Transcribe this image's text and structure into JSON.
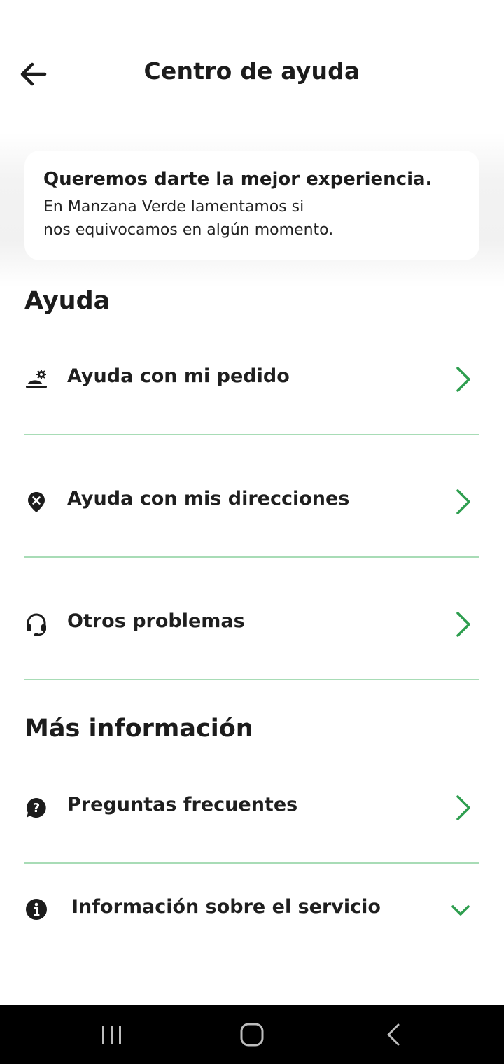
{
  "header": {
    "title": "Centro de ayuda",
    "back_icon": "arrow-left-icon"
  },
  "banner": {
    "title": "Queremos darte la mejor experiencia.",
    "text_line1": "En Manzana Verde lamentamos si",
    "text_line2": "nos equivocamos en algún momento."
  },
  "sections": {
    "help": {
      "title": "Ayuda",
      "items": [
        {
          "label": "Ayuda con mi pedido",
          "icon": "food-service-bell-icon"
        },
        {
          "label": "Ayuda con mis direcciones",
          "icon": "location-pin-x-icon"
        },
        {
          "label": "Otros problemas",
          "icon": "headset-icon"
        }
      ]
    },
    "more_info": {
      "title": "Más información",
      "items": [
        {
          "label": "Preguntas frecuentes",
          "icon": "question-bubble-icon"
        },
        {
          "label": "Información sobre el servicio",
          "icon": "info-circle-icon",
          "expanded": false
        }
      ]
    }
  },
  "colors": {
    "accent": "#2e9e4f",
    "divider": "#a8dcb6",
    "text": "#1c1c1c",
    "nav_background": "#000000"
  },
  "system_nav": {
    "recents_icon": "recents-icon",
    "home_icon": "home-icon",
    "back_icon": "back-chevron-icon"
  }
}
